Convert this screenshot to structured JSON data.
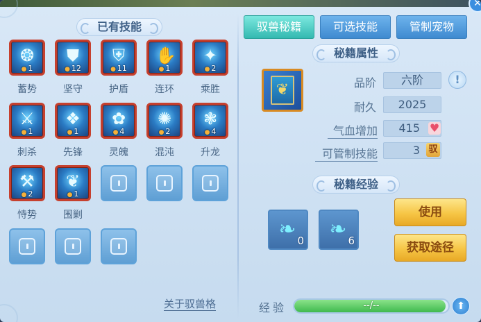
{
  "left": {
    "title": "已有技能",
    "skills": [
      {
        "name": "蓄势",
        "level": "1",
        "glyph": "❂"
      },
      {
        "name": "坚守",
        "level": "12",
        "glyph": "⛊"
      },
      {
        "name": "护盾",
        "level": "11",
        "glyph": "⛨"
      },
      {
        "name": "连环",
        "level": "1",
        "glyph": "✋"
      },
      {
        "name": "乘胜",
        "level": "2",
        "glyph": "✦"
      },
      {
        "name": "刺杀",
        "level": "1",
        "glyph": "⚔"
      },
      {
        "name": "先锋",
        "level": "1",
        "glyph": "❖"
      },
      {
        "name": "灵魄",
        "level": "4",
        "glyph": "✿"
      },
      {
        "name": "混沌",
        "level": "2",
        "glyph": "✺"
      },
      {
        "name": "升龙",
        "level": "4",
        "glyph": "❃"
      },
      {
        "name": "恃势",
        "level": "2",
        "glyph": "⚒"
      },
      {
        "name": "围剿",
        "level": "1",
        "glyph": "❦"
      }
    ],
    "about_link": "关于驭兽格"
  },
  "tabs": [
    {
      "label": "驭兽秘籍"
    },
    {
      "label": "可选技能"
    },
    {
      "label": "管制宠物"
    }
  ],
  "attributes": {
    "title": "秘籍属性",
    "rows": [
      {
        "label": "品阶",
        "value": "六阶"
      },
      {
        "label": "耐久",
        "value": "2025"
      },
      {
        "label": "气血增加",
        "value": "415"
      },
      {
        "label": "可管制技能",
        "value": "3"
      }
    ],
    "yu_badge": "驭",
    "info_glyph": "!"
  },
  "experience": {
    "title": "秘籍经验",
    "items": [
      {
        "count": "0",
        "glyph": "❧"
      },
      {
        "count": "6",
        "glyph": "❧"
      }
    ],
    "use_button": "使用",
    "obtain_button": "获取途径",
    "label": "经验",
    "progress_text": "--/--",
    "progress": 0.98
  },
  "colors": {
    "accent": "#34b9b1",
    "tab_blue": "#3f8ad0",
    "gold": "#f6c545",
    "skill_border": "#c6402e"
  }
}
